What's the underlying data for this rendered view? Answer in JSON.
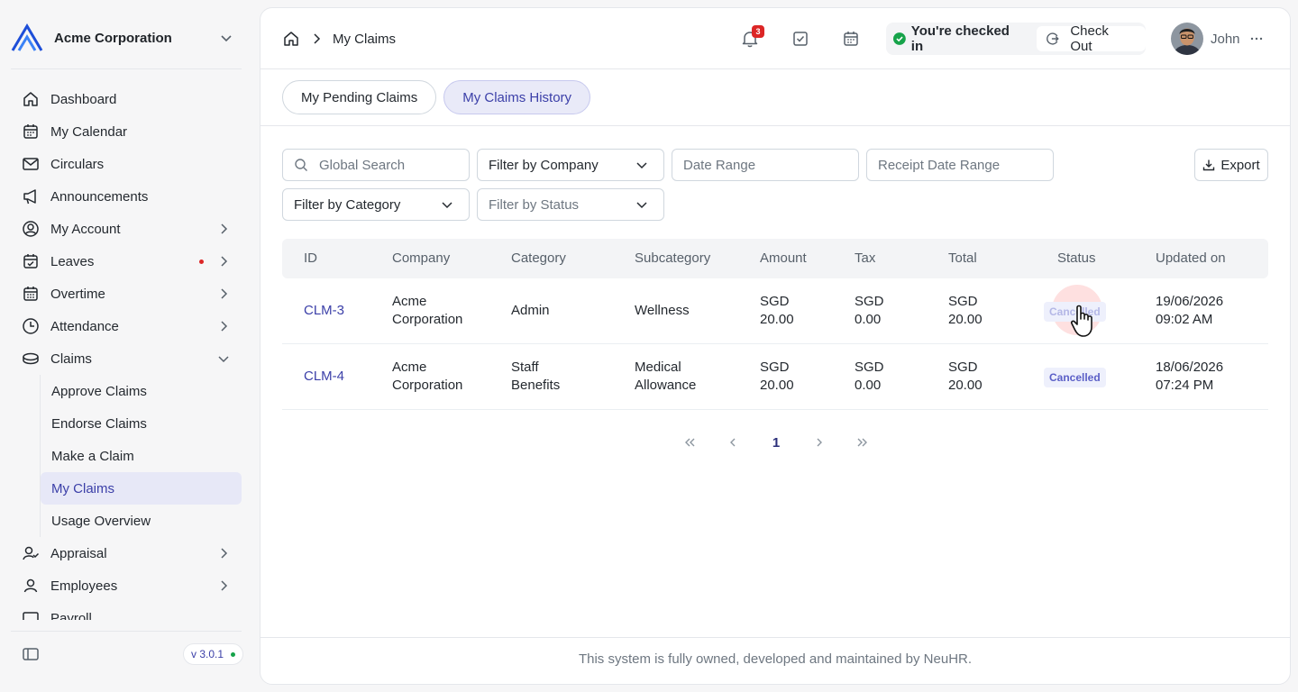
{
  "sidebar": {
    "company": "Acme Corporation",
    "items": [
      {
        "label": "Dashboard",
        "icon": "home-icon"
      },
      {
        "label": "My Calendar",
        "icon": "calendar-icon"
      },
      {
        "label": "Circulars",
        "icon": "mail-icon"
      },
      {
        "label": "Announcements",
        "icon": "megaphone-icon"
      },
      {
        "label": "My Account",
        "icon": "user-circle-icon"
      },
      {
        "label": "Leaves",
        "icon": "calendar-check-icon"
      },
      {
        "label": "Overtime",
        "icon": "calendar-grid-icon"
      },
      {
        "label": "Attendance",
        "icon": "clock-icon"
      },
      {
        "label": "Claims",
        "icon": "coins-icon"
      },
      {
        "label": "Appraisal",
        "icon": "user-check-icon"
      },
      {
        "label": "Employees",
        "icon": "user-icon"
      },
      {
        "label": "Payroll",
        "icon": "payroll-icon"
      }
    ],
    "claims_sub": [
      "Approve Claims",
      "Endorse Claims",
      "Make a Claim",
      "My Claims",
      "Usage Overview"
    ],
    "version": "v 3.0.1"
  },
  "header": {
    "breadcrumb": "My Claims",
    "notification_count": "3",
    "checkin_status": "You're checked in",
    "checkout_label": "Check Out",
    "user_name": "John"
  },
  "tabs": [
    "My Pending Claims",
    "My Claims History"
  ],
  "filters": {
    "search_placeholder": "Global Search",
    "company": "Filter by Company",
    "date_range": "Date Range",
    "receipt_date_range": "Receipt Date Range",
    "category": "Filter by Category",
    "status": "Filter by Status",
    "export_label": "Export"
  },
  "table": {
    "columns": [
      "ID",
      "Company",
      "Category",
      "Subcategory",
      "Amount",
      "Tax",
      "Total",
      "Status",
      "Updated on"
    ],
    "rows": [
      {
        "id": "CLM-3",
        "company": [
          "Acme",
          "Corporation"
        ],
        "category": [
          "Admin"
        ],
        "subcategory": [
          "Wellness"
        ],
        "amount": [
          "SGD",
          "20.00"
        ],
        "tax": [
          "SGD",
          "0.00"
        ],
        "total": [
          "SGD",
          "20.00"
        ],
        "status": "Cancelled",
        "updated": [
          "19/06/2026",
          "09:02 AM"
        ]
      },
      {
        "id": "CLM-4",
        "company": [
          "Acme",
          "Corporation"
        ],
        "category": [
          "Staff",
          "Benefits"
        ],
        "subcategory": [
          "Medical",
          "Allowance"
        ],
        "amount": [
          "SGD",
          "20.00"
        ],
        "tax": [
          "SGD",
          "0.00"
        ],
        "total": [
          "SGD",
          "20.00"
        ],
        "status": "Cancelled",
        "updated": [
          "18/06/2026",
          "07:24 PM"
        ]
      }
    ]
  },
  "pagination": {
    "current_page": "1"
  },
  "footer": "This system is fully owned, developed and maintained by NeuHR.",
  "colors": {
    "accent": "#3b3fa8",
    "status_pill_bg": "#eef0fc",
    "badge": "#dc2626",
    "online": "#16a34a"
  }
}
